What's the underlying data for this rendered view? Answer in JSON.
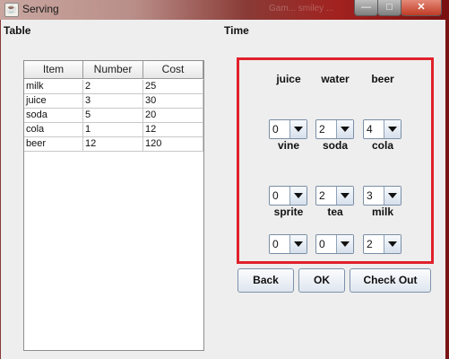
{
  "window": {
    "title": "Serving",
    "app_icon": "java-icon",
    "background_ghost_text": "Gam... smiley ...",
    "controls": {
      "minimize": "—",
      "maximize": "□",
      "close": "✕"
    }
  },
  "labels": {
    "table": "Table",
    "time": "Time"
  },
  "table": {
    "columns": [
      "Item",
      "Number",
      "Cost"
    ],
    "rows": [
      [
        "milk",
        "2",
        "25"
      ],
      [
        "juice",
        "3",
        "30"
      ],
      [
        "soda",
        "5",
        "20"
      ],
      [
        "cola",
        "1",
        "12"
      ],
      [
        "beer",
        "12",
        "120"
      ]
    ]
  },
  "drinks": [
    {
      "label": "juice",
      "value": "0"
    },
    {
      "label": "water",
      "value": "2"
    },
    {
      "label": "beer",
      "value": "4"
    },
    {
      "label": "vine",
      "value": "0"
    },
    {
      "label": "soda",
      "value": "2"
    },
    {
      "label": "cola",
      "value": "3"
    },
    {
      "label": "sprite",
      "value": "0"
    },
    {
      "label": "tea",
      "value": "0"
    },
    {
      "label": "milk",
      "value": "2"
    }
  ],
  "buttons": {
    "back": "Back",
    "ok": "OK",
    "checkout": "Check Out"
  },
  "colors": {
    "panel_border": "#e0212b",
    "window_bg": "#eeeeee",
    "close_button": "#c03b25"
  }
}
